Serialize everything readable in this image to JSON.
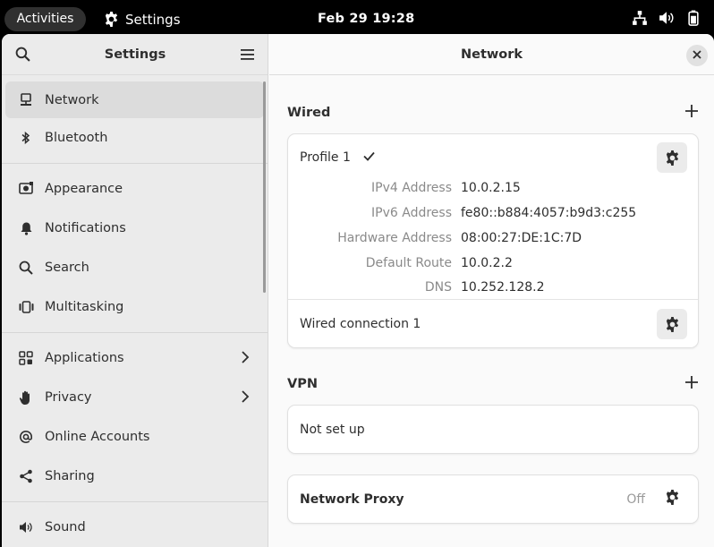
{
  "topbar": {
    "activities": "Activities",
    "app_name": "Settings",
    "clock": "Feb 29  19:28",
    "icons": [
      "network-wired-icon",
      "volume-icon",
      "battery-icon"
    ]
  },
  "sidebar": {
    "title": "Settings",
    "items": [
      {
        "label": "Network",
        "icon": "network-icon"
      },
      {
        "label": "Bluetooth",
        "icon": "bluetooth-icon"
      },
      {
        "label": "Appearance",
        "icon": "appearance-icon"
      },
      {
        "label": "Notifications",
        "icon": "bell-icon"
      },
      {
        "label": "Search",
        "icon": "search-icon"
      },
      {
        "label": "Multitasking",
        "icon": "multitasking-icon"
      },
      {
        "label": "Applications",
        "icon": "grid-icon"
      },
      {
        "label": "Privacy",
        "icon": "hand-icon"
      },
      {
        "label": "Online Accounts",
        "icon": "at-icon"
      },
      {
        "label": "Sharing",
        "icon": "share-icon"
      },
      {
        "label": "Sound",
        "icon": "speaker-icon"
      }
    ]
  },
  "main": {
    "title": "Network",
    "wired": {
      "title": "Wired",
      "profile_name": "Profile 1",
      "details": [
        {
          "label": "IPv4 Address",
          "value": "10.0.2.15"
        },
        {
          "label": "IPv6 Address",
          "value": "fe80::b884:4057:b9d3:c255"
        },
        {
          "label": "Hardware Address",
          "value": "08:00:27:DE:1C:7D"
        },
        {
          "label": "Default Route",
          "value": "10.0.2.2"
        },
        {
          "label": "DNS",
          "value": "10.252.128.2"
        }
      ],
      "connection_name": "Wired connection 1"
    },
    "vpn": {
      "title": "VPN",
      "status": "Not set up"
    },
    "proxy": {
      "title": "Network Proxy",
      "status": "Off"
    }
  },
  "colors": {
    "sidebar_bg": "#ebebeb",
    "selected_bg": "#dcdcdc",
    "card_bg": "#ffffff",
    "topbar_bg": "#000000"
  }
}
